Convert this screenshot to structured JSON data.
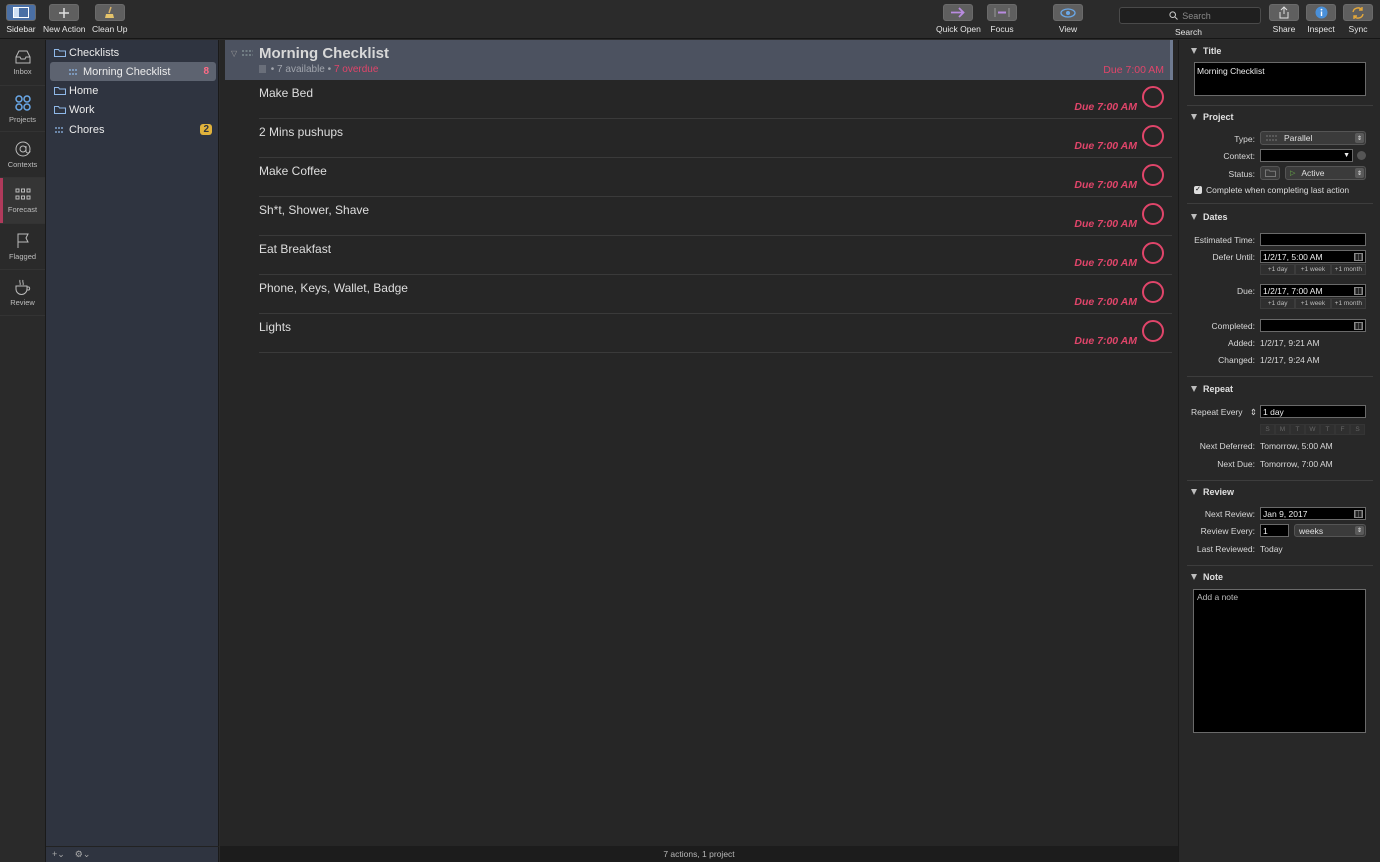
{
  "toolbar": {
    "sidebar": "Sidebar",
    "new_action": "New Action",
    "clean_up": "Clean Up",
    "quick_open": "Quick Open",
    "focus": "Focus",
    "view": "View",
    "search_placeholder": "Search",
    "search_label": "Search",
    "share": "Share",
    "inspect": "Inspect",
    "sync": "Sync"
  },
  "rail": {
    "inbox": "Inbox",
    "projects": "Projects",
    "contexts": "Contexts",
    "forecast": "Forecast",
    "flagged": "Flagged",
    "review": "Review"
  },
  "sidebar": {
    "items": [
      {
        "label": "Checklists",
        "icon": "folder-icon",
        "count": ""
      },
      {
        "label": "Morning Checklist",
        "icon": "parallel-icon",
        "count": "8"
      },
      {
        "label": "Home",
        "icon": "folder-icon",
        "count": ""
      },
      {
        "label": "Work",
        "icon": "folder-icon",
        "count": ""
      },
      {
        "label": "Chores",
        "icon": "parallel-icon",
        "count": "2"
      }
    ]
  },
  "project": {
    "title": "Morning Checklist",
    "available": "• 7 available •",
    "overdue": "7 overdue",
    "due": "Due 7:00 AM"
  },
  "tasks": [
    {
      "name": "Make Bed",
      "due": "Due 7:00 AM"
    },
    {
      "name": "2 Mins pushups",
      "due": "Due 7:00 AM"
    },
    {
      "name": "Make Coffee",
      "due": "Due 7:00 AM"
    },
    {
      "name": "Sh*t, Shower, Shave",
      "due": "Due 7:00 AM"
    },
    {
      "name": "Eat Breakfast",
      "due": "Due 7:00 AM"
    },
    {
      "name": "Phone, Keys, Wallet, Badge",
      "due": "Due 7:00 AM"
    },
    {
      "name": "Lights",
      "due": "Due 7:00 AM"
    }
  ],
  "status_bar": "7 actions, 1 project",
  "inspector": {
    "title_section": "Title",
    "title_value": "Morning Checklist",
    "project_section": "Project",
    "type_label": "Type:",
    "type_value": "Parallel",
    "context_label": "Context:",
    "status_label": "Status:",
    "status_value": "Active",
    "complete_last": "Complete when completing last action",
    "dates_section": "Dates",
    "estimated_label": "Estimated Time:",
    "defer_label": "Defer Until:",
    "defer_value": "1/2/17, 5:00 AM",
    "plus_day": "+1 day",
    "plus_week": "+1 week",
    "plus_month": "+1 month",
    "due_label": "Due:",
    "due_value": "1/2/17, 7:00 AM",
    "completed_label": "Completed:",
    "added_label": "Added:",
    "added_value": "1/2/17, 9:21 AM",
    "changed_label": "Changed:",
    "changed_value": "1/2/17, 9:24 AM",
    "repeat_section": "Repeat",
    "repeat_every_label": "Repeat Every",
    "repeat_every_value": "1 day",
    "weekdays": [
      "S",
      "M",
      "T",
      "W",
      "T",
      "F",
      "S"
    ],
    "next_deferred_label": "Next Deferred:",
    "next_deferred_value": "Tomorrow, 5:00 AM",
    "next_due_label": "Next Due:",
    "next_due_value": "Tomorrow, 7:00 AM",
    "review_section": "Review",
    "next_review_label": "Next Review:",
    "next_review_value": "Jan 9, 2017",
    "review_every_label": "Review Every:",
    "review_every_num": "1",
    "review_every_unit": "weeks",
    "last_reviewed_label": "Last Reviewed:",
    "last_reviewed_value": "Today",
    "note_section": "Note",
    "note_placeholder": "Add a note"
  },
  "colors": {
    "overdue": "#e0456a",
    "sidebar_bg": "#2f3440",
    "header_bg": "#4c5260",
    "accent_blue": "#4a90d9"
  }
}
